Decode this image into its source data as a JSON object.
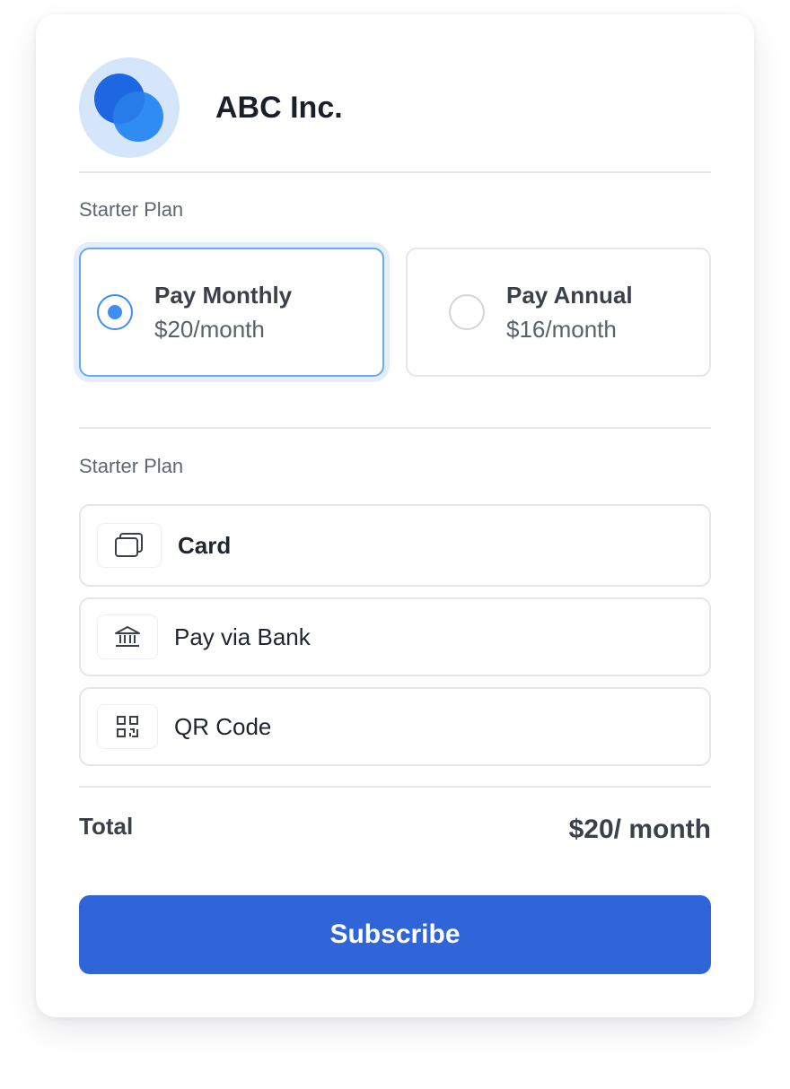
{
  "company": {
    "name": "ABC Inc.",
    "logo_icon": "overlapping-circles-logo"
  },
  "billing": {
    "section_label": "Starter Plan",
    "options": [
      {
        "name": "Pay Monthly",
        "price": "$20/month",
        "selected": true
      },
      {
        "name": "Pay Annual",
        "price": "$16/month",
        "selected": false
      }
    ]
  },
  "payment": {
    "section_label": "Starter Plan",
    "methods": [
      {
        "label": "Card",
        "icon": "card-icon"
      },
      {
        "label": "Pay via Bank",
        "icon": "bank-icon"
      },
      {
        "label": "QR Code",
        "icon": "qr-code-icon"
      }
    ]
  },
  "summary": {
    "total_label": "Total",
    "total_value": "$20/ month"
  },
  "actions": {
    "subscribe_label": "Subscribe"
  },
  "colors": {
    "accent": "#2f65d9",
    "radio_selected": "#3d8ef0",
    "logo_bg": "#d5e6fb"
  }
}
